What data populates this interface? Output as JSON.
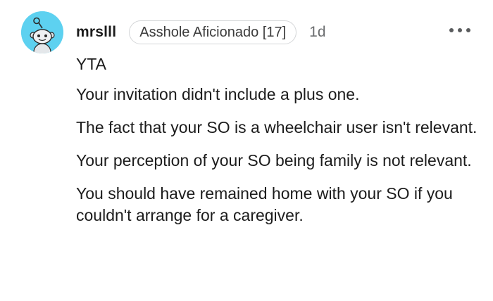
{
  "comment": {
    "avatar_icon": "reddit-snoo-avatar-icon",
    "avatar_color": "#5dd1f0",
    "username": "mrslll",
    "flair": "Asshole Aficionado [17]",
    "timestamp": "1d",
    "more_icon": "more-options-icon",
    "paragraphs": [
      "YTA",
      "Your invitation didn't include a plus one.",
      "The fact that your SO is a wheelchair user isn't relevant.",
      "Your perception of your SO being family is not relevant.",
      "You should have remained home with your SO if you couldn't arrange for a caregiver."
    ]
  }
}
